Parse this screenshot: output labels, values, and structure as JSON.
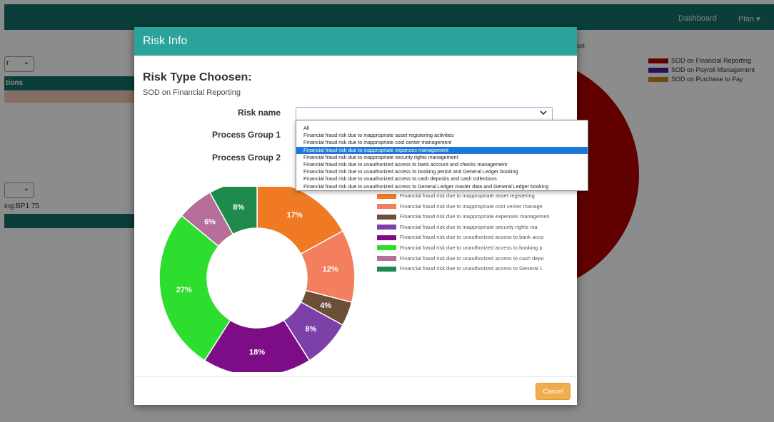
{
  "background": {
    "nav": {
      "dashboard": "Dashboard",
      "plan": "Plan ▾"
    },
    "partial_header": "tions",
    "partial_text": "ing:BP1 75",
    "partial_select": "r",
    "partial_set": "set",
    "legend": [
      {
        "label": "SOD on Financial Reporting",
        "color": "#b00000"
      },
      {
        "label": "SOD on Payroll Management",
        "color": "#4a1aa0"
      },
      {
        "label": "SOD on Purchase to Pay",
        "color": "#c8861e"
      }
    ]
  },
  "modal": {
    "title": "Risk Info",
    "risk_type_heading": "Risk Type Choosen:",
    "risk_type_value": "SOD on Financial Reporting",
    "labels": {
      "risk_name": "Risk name",
      "process_group_1": "Process Group 1",
      "process_group_2": "Process Group 2"
    },
    "risk_name_value": "",
    "dropdown_options": [
      "All",
      "Financial fraud risk due to inappropriate asset registering activities",
      "Financial fraud risk due to inappropriate cost center management",
      "Financial fraud risk due to inappropriate expenses management",
      "Financial fraud risk due to inappropriate security rights management",
      "Financial fraud risk due to unauthorized access to bank account and checks management",
      "Financial fraud risk due to unauthorized access to booking period and General Ledger booking",
      "Financial fraud risk due to unauthorized access to cash deposits and cash collections",
      "Financial fraud risk due to unauthorized access to General Ledger master data and General Ledger booking"
    ],
    "dropdown_selected_index": 3,
    "cancel_label": "Cancel"
  },
  "chart_data": {
    "type": "pie",
    "donut": true,
    "categories": [
      "Financial fraud risk due to inappropriate asset registering",
      "Financial fraud risk due to inappropriate cost center manage",
      "Financial fraud risk due to inappropriate expenses managemen",
      "Financial fraud risk due to inappropriate security rights ma",
      "Financial fraud risk due to unauthorized access to bank acco",
      "Financial fraud risk due to unauthorized access to booking p",
      "Financial fraud risk due to unauthorized access to cash depo",
      "Financial fraud risk due to unauthorized access to General L"
    ],
    "values": [
      17,
      12,
      4,
      8,
      18,
      27,
      6,
      8
    ],
    "labels": [
      "17%",
      "12%",
      "4%",
      "8%",
      "18%",
      "27%",
      "6%",
      "8%"
    ],
    "colors": [
      "#f07a24",
      "#f47f5f",
      "#6b4f36",
      "#7d3fa8",
      "#7d0d86",
      "#2ede2e",
      "#b56f98",
      "#1e8a4c"
    ],
    "legend_position": "right"
  }
}
